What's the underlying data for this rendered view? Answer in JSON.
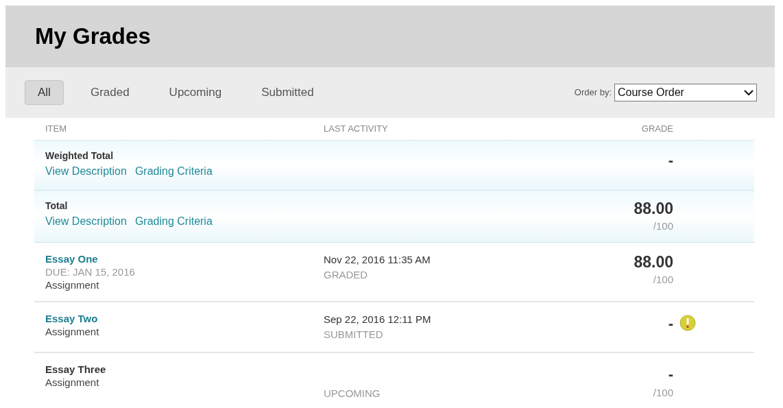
{
  "title": "My Grades",
  "filters": [
    {
      "label": "All",
      "selected": true
    },
    {
      "label": "Graded",
      "selected": false
    },
    {
      "label": "Upcoming",
      "selected": false
    },
    {
      "label": "Submitted",
      "selected": false
    }
  ],
  "order_by": {
    "label": "Order by:",
    "value": "Course Order"
  },
  "table": {
    "columns": [
      "ITEM",
      "LAST ACTIVITY",
      "GRADE"
    ],
    "rows": [
      {
        "kind": "total",
        "title": "Weighted Total",
        "links": [
          "View Description",
          "Grading Criteria"
        ],
        "grade": "-"
      },
      {
        "kind": "total",
        "title": "Total",
        "links": [
          "View Description",
          "Grading Criteria"
        ],
        "grade": "88.00",
        "out_of": "/100"
      },
      {
        "kind": "item",
        "title": "Essay One",
        "is_link": true,
        "due": "DUE: JAN 15, 2016",
        "type": "Assignment",
        "activity": "Nov 22, 2016 11:35 AM",
        "status": "GRADED",
        "grade": "88.00",
        "out_of": "/100",
        "warning": false
      },
      {
        "kind": "item",
        "title": "Essay Two",
        "is_link": true,
        "type": "Assignment",
        "activity": "Sep 22, 2016 12:11 PM",
        "status": "SUBMITTED",
        "grade": "-",
        "warning": true
      },
      {
        "kind": "item",
        "title": "Essay Three",
        "is_link": false,
        "type": "Assignment",
        "status": "UPCOMING",
        "grade": "-",
        "out_of": "/100",
        "warning": false
      }
    ]
  }
}
